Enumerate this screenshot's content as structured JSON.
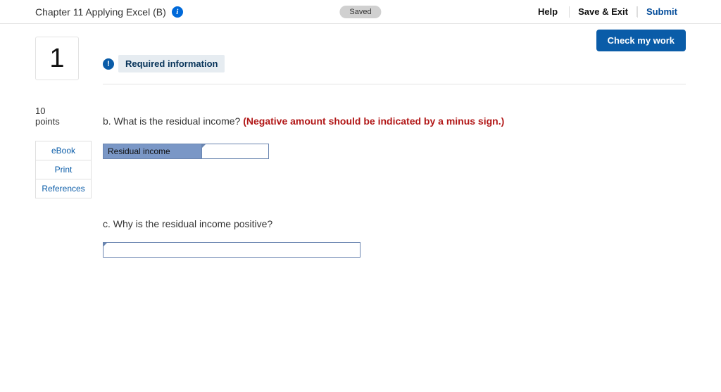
{
  "header": {
    "title": "Chapter 11 Applying Excel (B)",
    "saved_label": "Saved",
    "actions": {
      "help": "Help",
      "save_exit": "Save & Exit",
      "submit": "Submit"
    }
  },
  "check_work_label": "Check my work",
  "question_number": "1",
  "points": {
    "value": "10",
    "label": "points"
  },
  "side_links": {
    "ebook": "eBook",
    "print": "Print",
    "references": "References"
  },
  "required_info_label": "Required information",
  "part_b": {
    "prompt": "b. What is the residual income? ",
    "hint": "(Negative amount should be indicated by a minus sign.)",
    "row_label": "Residual income",
    "input_value": ""
  },
  "part_c": {
    "prompt": "c. Why is the residual income positive?",
    "input_value": ""
  }
}
